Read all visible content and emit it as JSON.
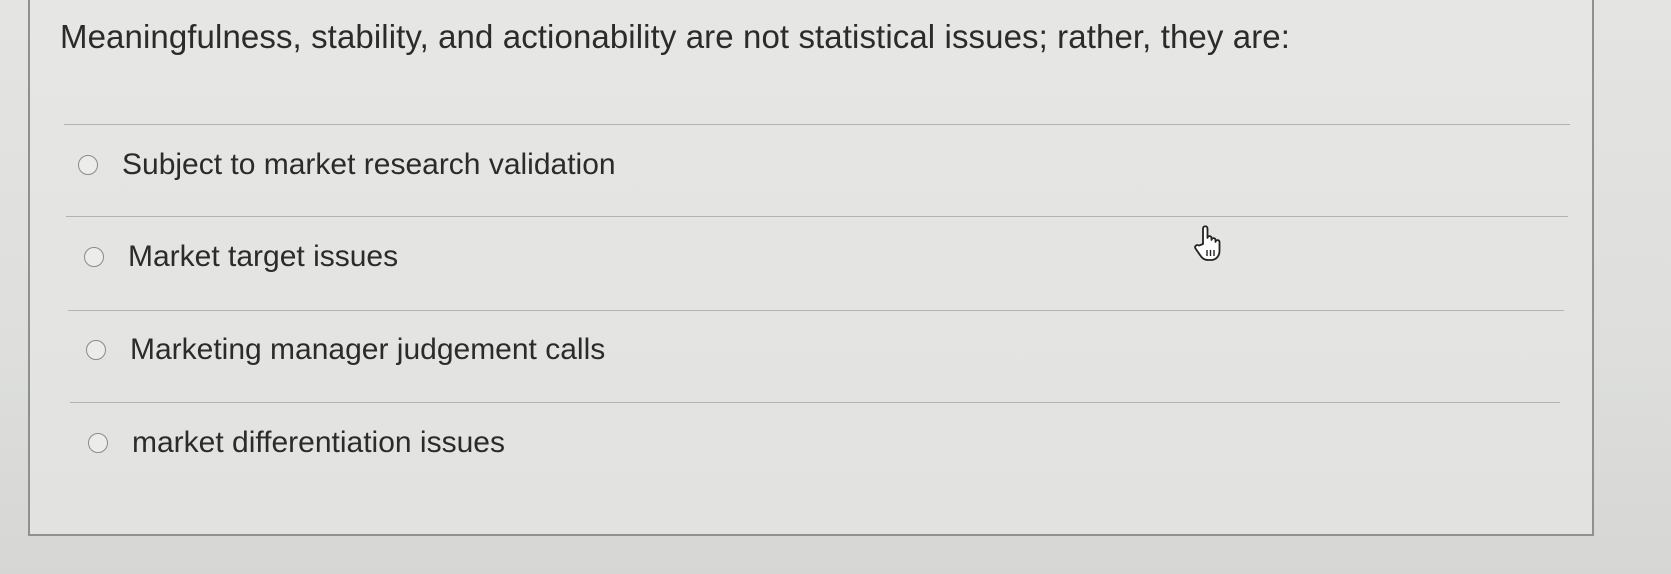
{
  "question": {
    "text": "Meaningfulness, stability, and actionability are not statistical issues; rather, they are:"
  },
  "options": [
    {
      "label": "Subject to market research validation",
      "selected": false
    },
    {
      "label": "Market target issues",
      "selected": false
    },
    {
      "label": "Marketing manager judgement calls",
      "selected": false
    },
    {
      "label": "market differentiation issues",
      "selected": false
    }
  ],
  "cursor": {
    "icon": "hand-pointer-icon"
  }
}
